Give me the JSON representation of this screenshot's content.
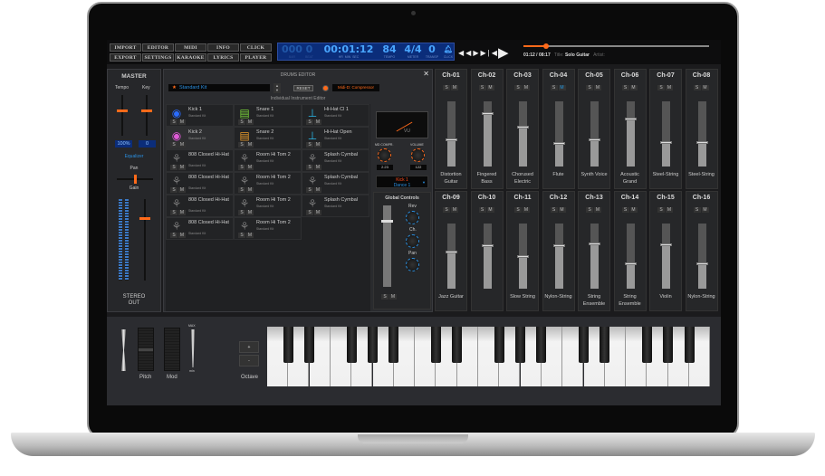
{
  "menu": {
    "row1": [
      "IMPORT",
      "EDITOR",
      "MIDI",
      "INFO",
      "CLICK"
    ],
    "row2": [
      "EXPORT",
      "SETTINGS",
      "KARAOKE",
      "LYRICS",
      "PLAYER"
    ]
  },
  "display": {
    "bar": "000",
    "beat": "0",
    "time": "00:01:12",
    "tempo": "84",
    "meter": "4/4",
    "transp": "0",
    "labels": {
      "bar": "BAR",
      "beat": "BEAT",
      "hr": "HR",
      "min": "MIN",
      "sec": "SEC",
      "tempo": "TEMPO",
      "meter": "METER",
      "transp": "TRANSP",
      "click": "CLICK"
    }
  },
  "transport": {
    "time": "01:12 / 08:17",
    "title_label": "Title:",
    "title": "Solo Guitar",
    "artist_label": "Artist:",
    "progress": 0.12
  },
  "master": {
    "title": "MASTER",
    "tempo_label": "Tempo",
    "key_label": "Key",
    "tempo_value": "100%",
    "key_value": "0",
    "equalizer": "Equalizer",
    "pan": "Pan",
    "gain": "Gain",
    "out": "STEREO OUT"
  },
  "drums": {
    "title": "DRUMS EDITOR",
    "kit": "Standard Kit",
    "reset": "RESET",
    "effect": "Midi-D: Compressor",
    "subtitle": "Individual Instrument Editor",
    "pads": [
      {
        "name": "Kick 1",
        "kit": "Standard Kit",
        "color": "#2a6cff"
      },
      {
        "name": "Snare 1",
        "kit": "Standard Kit",
        "color": "#7ad53a"
      },
      {
        "name": "Hi-Hat Cl 1",
        "kit": "Standard Kit",
        "color": "#2ab8e8"
      },
      {
        "name": "Kick 2",
        "kit": "Standard Kit",
        "color": "#e05ad8"
      },
      {
        "name": "Snare 2",
        "kit": "Standard Kit",
        "color": "#e89a2a"
      },
      {
        "name": "Hi-Hat Open",
        "kit": "Standard Kit",
        "color": "#2ab8e8"
      },
      {
        "name": "808 Closed Hi-Hat",
        "kit": "Standard Kit",
        "color": "#777"
      },
      {
        "name": "Room Hi Tom 2",
        "kit": "Standard Kit",
        "color": "#777"
      },
      {
        "name": "Splash Cymbal",
        "kit": "Standard Kit",
        "color": "#777"
      },
      {
        "name": "808 Closed Hi-Hat",
        "kit": "Standard Kit",
        "color": "#777"
      },
      {
        "name": "Room Hi Tom 2",
        "kit": "Standard Kit",
        "color": "#777"
      },
      {
        "name": "Splash Cymbal",
        "kit": "Standard Kit",
        "color": "#777"
      },
      {
        "name": "808 Closed Hi-Hat",
        "kit": "Standard Kit",
        "color": "#777"
      },
      {
        "name": "Room Hi Tom 2",
        "kit": "Standard Kit",
        "color": "#777"
      },
      {
        "name": "Splash Cymbal",
        "kit": "Standard Kit",
        "color": "#777"
      },
      {
        "name": "808 Closed Hi-Hat",
        "kit": "Standard Kit",
        "color": "#777"
      },
      {
        "name": "Room Hi Tom 2",
        "kit": "Standard Kit",
        "color": "#777"
      }
    ],
    "vu_label": "VU",
    "compr_label": "MD COMPR.",
    "compr_value": "2.23",
    "volume_label": "VOLUME",
    "volume_value": "122",
    "preset_line1": "Kick 1",
    "preset_line2": "Dance 1",
    "global": "Global Controls",
    "rev": "Rev",
    "ch": "Ch.",
    "pan": "Pan"
  },
  "solo": "S",
  "mute": "M",
  "channels": [
    {
      "id": "Ch-01",
      "name": "Distortion Guitar",
      "level": 0.4
    },
    {
      "id": "Ch-02",
      "name": "Fingered Bass",
      "level": 0.8
    },
    {
      "id": "Ch-03",
      "name": "Chorused Electric",
      "level": 0.6
    },
    {
      "id": "Ch-04",
      "name": "Flute",
      "level": 0.35,
      "muted": true
    },
    {
      "id": "Ch-05",
      "name": "Synth Voice",
      "level": 0.4
    },
    {
      "id": "Ch-06",
      "name": "Acoustic Grand",
      "level": 0.72
    },
    {
      "id": "Ch-07",
      "name": "Steel-String",
      "level": 0.36
    },
    {
      "id": "Ch-08",
      "name": "Steel-String",
      "level": 0.36
    },
    {
      "id": "Ch-09",
      "name": "Jazz Guitar",
      "level": 0.55
    },
    {
      "id": "Ch-10",
      "name": "",
      "level": 0.65
    },
    {
      "id": "Ch-11",
      "name": "Slow String",
      "level": 0.48
    },
    {
      "id": "Ch-12",
      "name": "Nylon-String",
      "level": 0.65
    },
    {
      "id": "Ch-13",
      "name": "String Ensemble",
      "level": 0.68
    },
    {
      "id": "Ch-14",
      "name": "String Ensemble",
      "level": 0.38
    },
    {
      "id": "Ch-15",
      "name": "Violin",
      "level": 0.66
    },
    {
      "id": "Ch-16",
      "name": "Nylon-String",
      "level": 0.38
    }
  ],
  "keyboard": {
    "pitch": "Pitch",
    "mod": "Mod",
    "max": "MAX",
    "min": "min",
    "plus": "+",
    "minus": "-",
    "octave": "Octave",
    "white_keys": 21
  },
  "colors": {
    "accent": "#ff6a1a",
    "lcd_text": "#49a6ff",
    "mute_active": "#1f9ae8"
  }
}
